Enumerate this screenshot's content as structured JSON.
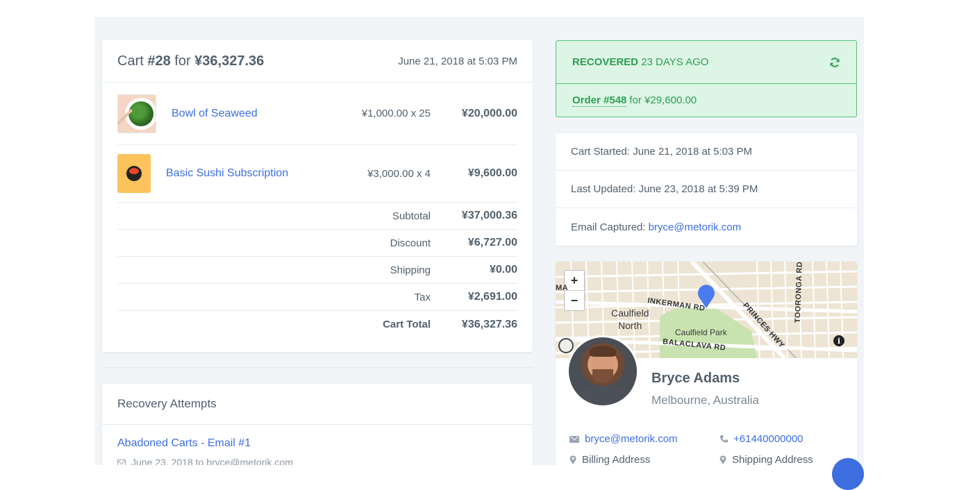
{
  "cart": {
    "title_prefix": "Cart ",
    "title_number": "#28",
    "title_middle": " for ",
    "title_amount": "¥36,327.36",
    "date": "June 21, 2018 at 5:03 PM",
    "items": [
      {
        "name": "Bowl of Seaweed",
        "qty": "¥1,000.00 x 25",
        "total": "¥20,000.00"
      },
      {
        "name": "Basic Sushi Subscription",
        "qty": "¥3,000.00 x 4",
        "total": "¥9,600.00"
      }
    ],
    "summary": [
      {
        "label": "Subtotal",
        "value": "¥37,000.36"
      },
      {
        "label": "Discount",
        "value": "¥6,727.00"
      },
      {
        "label": "Shipping",
        "value": "¥0.00"
      },
      {
        "label": "Tax",
        "value": "¥2,691.00"
      },
      {
        "label": "Cart Total",
        "value": "¥36,327.36"
      }
    ]
  },
  "recovery": {
    "heading": "Recovery Attempts",
    "attempt_link": "Abadoned Carts - Email #1",
    "attempt_detail": "June 23, 2018 to bryce@metorik.com"
  },
  "status": {
    "label_bold": "RECOVERED",
    "label_rest": " 23 DAYS AGO",
    "order_link": "Order #548",
    "order_rest": "for ¥29,600.00",
    "color": "#2f9e57",
    "background": "#dcf5e4"
  },
  "meta": {
    "started": "Cart Started: June 21, 2018 at 5:03 PM",
    "updated": "Last Updated: June 23, 2018 at 5:39 PM",
    "email_label": "Email Captured:",
    "email_value": "bryce@metorik.com"
  },
  "map": {
    "zoom_in": "+",
    "zoom_out": "−",
    "info": "i",
    "labels": {
      "suburb_line1": "Caulfield",
      "suburb_line2": "North",
      "park": "Caulfield Park",
      "road_inkerman": "INKERMAN RD",
      "road_balaclava": "BALACLAVA RD",
      "road_princes": "PRINCES HWY",
      "road_tooronga": "TOORONGA RD",
      "edge_left": "MA"
    }
  },
  "customer": {
    "name": "Bryce Adams",
    "location": "Melbourne, Australia",
    "email": "bryce@metorik.com",
    "phone": "+61440000000",
    "billing": "Billing Address",
    "shipping": "Shipping Address"
  },
  "colors": {
    "link": "#3d6ee0",
    "text": "#52606d",
    "page_bg": "#f1f5f8"
  }
}
